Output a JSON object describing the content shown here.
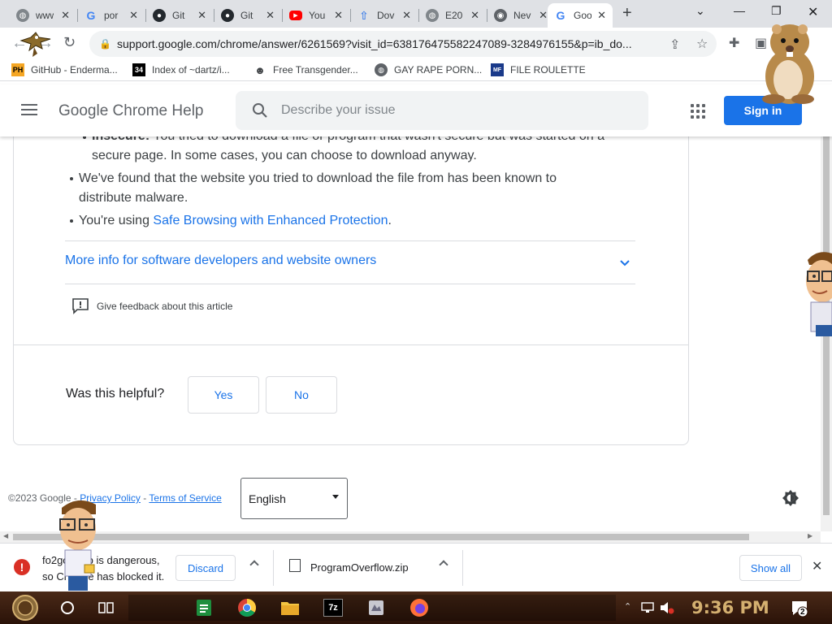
{
  "tabs": [
    {
      "label": "www",
      "favicon": "globe-icon"
    },
    {
      "label": "por",
      "favicon": "google-icon"
    },
    {
      "label": "Git",
      "favicon": "github-icon"
    },
    {
      "label": "Git",
      "favicon": "github-icon"
    },
    {
      "label": "You",
      "favicon": "youtube-icon"
    },
    {
      "label": "Dov",
      "favicon": "upload-icon"
    },
    {
      "label": "E20",
      "favicon": "globe-icon"
    },
    {
      "label": "Nev",
      "favicon": "chrome-icon"
    },
    {
      "label": "Goo",
      "favicon": "google-icon",
      "active": true
    }
  ],
  "address_bar": {
    "url": "support.google.com/chrome/answer/6261569?visit_id=638176475582247089-3284976155&p=ib_do..."
  },
  "bookmarks": [
    {
      "label": "GitHub - Enderma...",
      "icon": "PH"
    },
    {
      "label": "Index of ~dartz/i...",
      "icon": "34"
    },
    {
      "label": "Free Transgender...",
      "icon": "mask-icon"
    },
    {
      "label": "GAY RAPE PORN...",
      "icon": "globe-icon"
    },
    {
      "label": "FILE ROULETTE",
      "icon": "MF"
    }
  ],
  "help_header": {
    "title": "Google Chrome Help",
    "search_placeholder": "Describe your issue",
    "signin_label": "Sign in"
  },
  "article": {
    "bullet_insecure_bold": "Insecure:",
    "bullet_insecure_text": "You tried to download a file or program that wasn't secure but was started on a",
    "bullet_insecure_cont": "secure page. In some cases, you can choose to download anyway.",
    "bullet_malware_1": "We've found that the website you tried to download the file from has been known to",
    "bullet_malware_2": "distribute malware.",
    "bullet_safe_prefix": "You're using ",
    "bullet_safe_link": "Safe Browsing with Enhanced Protection",
    "bullet_safe_suffix": ".",
    "more_info": "More info for software developers and website owners",
    "feedback": "Give feedback about this article",
    "helpful_question": "Was this helpful?",
    "yes_label": "Yes",
    "no_label": "No"
  },
  "footer": {
    "copyright": "©2023 Google",
    "sep1": " - ",
    "privacy": "Privacy Policy",
    "sep2": " - ",
    "terms": "Terms of Service",
    "language": "English"
  },
  "download_shelf": {
    "warning_line1": "fo2gold.zip is dangerous,",
    "warning_line2": "so Chrome has blocked it.",
    "discard_label": "Discard",
    "file_name": "ProgramOverflow.zip",
    "show_all_label": "Show all"
  },
  "taskbar": {
    "time": "9:36 PM",
    "notification_count": "2"
  },
  "colors": {
    "accent": "#1a73e8",
    "error": "#d93025",
    "taskbar": "#2a1208"
  }
}
